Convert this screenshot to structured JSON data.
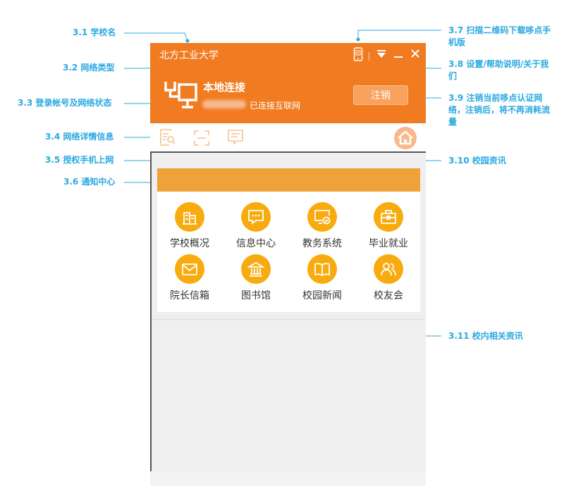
{
  "annotations": {
    "school_name": "3.1 学校名",
    "network_type": "3.2 网络类型",
    "account_status": "3.3 登录帐号及网络状态",
    "network_details": "3.4 网络详情信息",
    "authorize_phone": "3.5 授权手机上网",
    "notify_center": "3.6 通知中心",
    "scan_qr": "3.7 扫描二维码下载哆点手机版",
    "settings": "3.8 设置/帮助说明/关于我们",
    "logout_note": "3.9 注销当前哆点认证网络，注销后，将不再消耗流量",
    "campus_news": "3.10 校园资讯",
    "campus_info": "3.11 校内相关资讯"
  },
  "window": {
    "school_name": "北方工业大学",
    "connection_title": "本地连接",
    "status_text": "已连接互联网",
    "logout_label": "注销"
  },
  "services": [
    {
      "label": "学校概况",
      "icon": "building-icon"
    },
    {
      "label": "信息中心",
      "icon": "message-icon"
    },
    {
      "label": "教务系统",
      "icon": "monitor-check-icon"
    },
    {
      "label": "毕业就业",
      "icon": "briefcase-icon"
    },
    {
      "label": "院长信箱",
      "icon": "mail-icon"
    },
    {
      "label": "图书馆",
      "icon": "library-icon"
    },
    {
      "label": "校园新闻",
      "icon": "book-icon"
    },
    {
      "label": "校友会",
      "icon": "people-icon"
    }
  ],
  "colors": {
    "header": "#f07b21",
    "accent_band": "#f0a23a",
    "service_circle": "#f8ab0f",
    "annotation": "#29a9e1"
  }
}
